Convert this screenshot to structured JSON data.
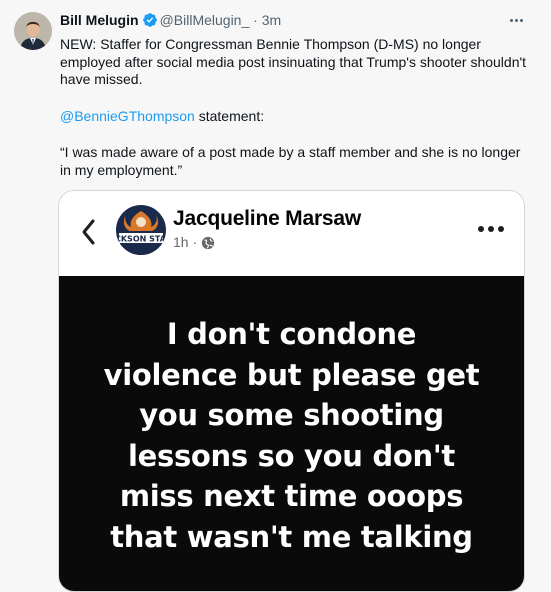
{
  "tweet": {
    "name": "Bill Melugin",
    "handle": "@BillMelugin_",
    "separator": "·",
    "time": "3m",
    "paragraph1": "NEW: Staffer for Congressman Bennie Thompson (D-MS) no longer employed after social media post insinuating that Trump's shooter shouldn't have missed.",
    "mention": "@BennieGThompson",
    "mention_suffix": " statement:",
    "quote": "“I was made aware of a post made by a staff member and she is no longer in my employment.”"
  },
  "embedded_post": {
    "author": "Jacqueline Marsaw",
    "time": "1h",
    "separator": "·",
    "avatar_logo_text": "JACKSON STATE",
    "text_lines": [
      "I don't condone",
      "violence but please get",
      "you some  shooting",
      "lessons so you don't",
      "miss next time ooops",
      "that wasn't me talking"
    ]
  },
  "icons": {
    "verified": "verified-badge-icon",
    "more": "more-options-icon",
    "back": "back-arrow-icon",
    "globe": "globe-icon"
  },
  "colors": {
    "link": "#1d9bf0",
    "verified": "#1d9bf0",
    "post_background": "#0a0a0a",
    "post_text": "#ffffff"
  }
}
